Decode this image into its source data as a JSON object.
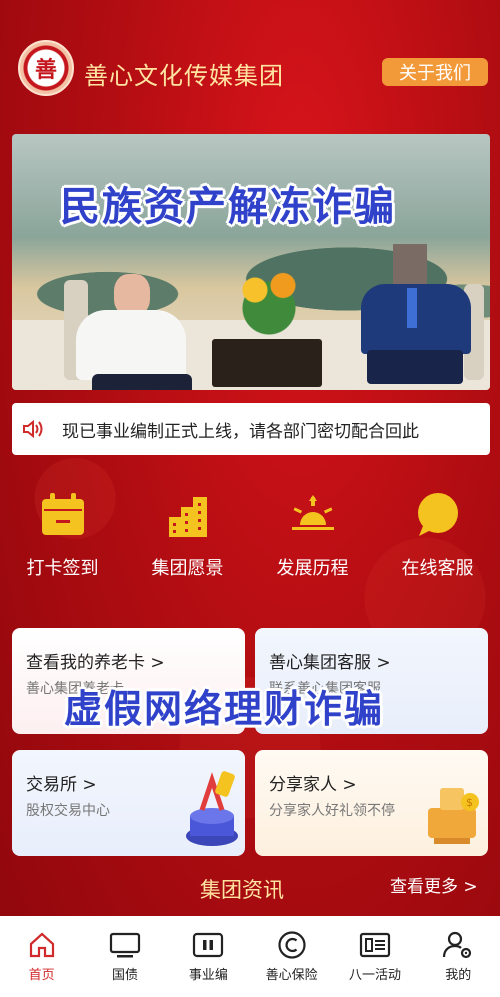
{
  "header": {
    "logo_text": "善",
    "title": "善心文化传媒集团",
    "about_button": "关于我们"
  },
  "banner": {
    "caption": "民族资产解冻诈骗"
  },
  "notice": {
    "text": "现已事业编制正式上线，请各部门密切配合回此"
  },
  "quick_actions": [
    {
      "label": "打卡签到",
      "icon": "calendar-icon"
    },
    {
      "label": "集团愿景",
      "icon": "buildings-icon"
    },
    {
      "label": "发展历程",
      "icon": "sunrise-icon"
    },
    {
      "label": "在线客服",
      "icon": "chat-icon"
    }
  ],
  "cards": [
    {
      "title": "查看我的养老卡 >",
      "subtitle": "善心集团养老卡"
    },
    {
      "title": "善心集团客服 >",
      "subtitle": "联系善心集团客服"
    },
    {
      "title": "交易所 >",
      "subtitle": "股权交易中心"
    },
    {
      "title": "分享家人 >",
      "subtitle": "分享家人好礼领不停"
    }
  ],
  "overlay_caption": "虚假网络理财诈骗",
  "news": {
    "title": "集团资讯",
    "more": "查看更多 >"
  },
  "tabs": [
    {
      "label": "首页",
      "icon": "home-icon",
      "active": true
    },
    {
      "label": "国债",
      "icon": "monitor-icon",
      "active": false
    },
    {
      "label": "事业编",
      "icon": "pause-box-icon",
      "active": false
    },
    {
      "label": "善心保险",
      "icon": "copyright-icon",
      "active": false
    },
    {
      "label": "八一活动",
      "icon": "document-icon",
      "active": false
    },
    {
      "label": "我的",
      "icon": "user-gear-icon",
      "active": false
    }
  ],
  "colors": {
    "primary_red": "#c4161c",
    "gold_text": "#ffe3a0",
    "about_button": "#f29a3a",
    "icon_yellow": "#f5c31f",
    "active_tab": "#d12a2a"
  }
}
